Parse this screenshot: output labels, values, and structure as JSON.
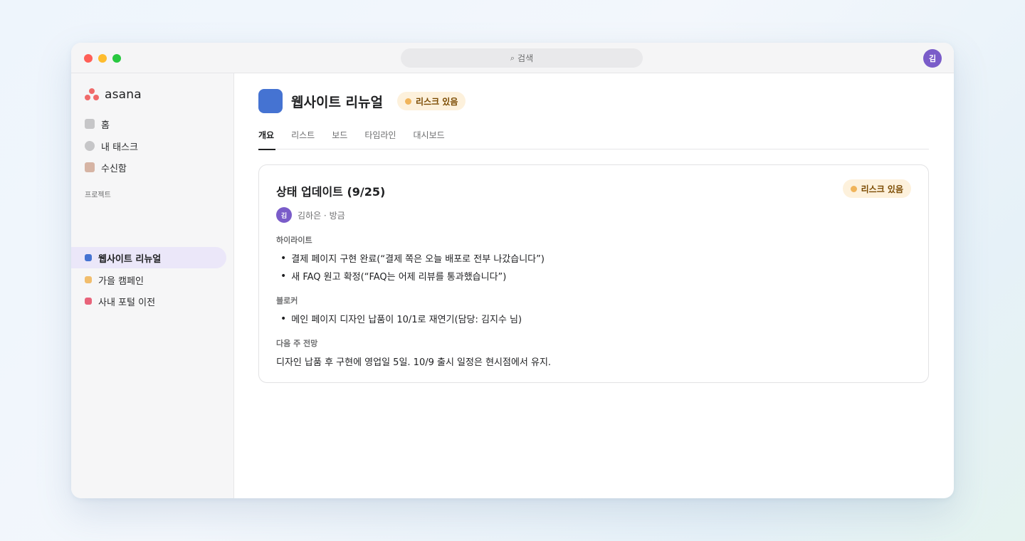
{
  "window": {
    "search_placeholder": "검색",
    "user_initial": "김"
  },
  "sidebar": {
    "logo": "asana",
    "nav": [
      {
        "label": "홈",
        "icon": "home-icon",
        "color": "#c6c6c8"
      },
      {
        "label": "내 태스크",
        "icon": "check-circle-icon",
        "color": "#c6c6c8"
      },
      {
        "label": "수신함",
        "icon": "inbox-icon",
        "color": "#d6b4a4"
      }
    ],
    "section_label": "프로젝트",
    "projects": [
      {
        "label": "웹사이트 리뉴얼",
        "color": "#4573d2",
        "active": true
      },
      {
        "label": "가을 캠페인",
        "color": "#f1bd6c",
        "active": false
      },
      {
        "label": "사내 포털 이전",
        "color": "#e8637a",
        "active": false
      }
    ]
  },
  "project": {
    "title": "웹사이트 리뉴얼",
    "color": "#4573d2",
    "status": "리스크 있음",
    "status_color": "#f0b45a"
  },
  "tabs": [
    "개요",
    "리스트",
    "보드",
    "타임라인",
    "대시보드"
  ],
  "active_tab": "개요",
  "update": {
    "title": "상태 업데이트 (9/25)",
    "status": "리스크 있음",
    "author_initial": "김",
    "author_meta": "김하은 · 방금",
    "highlights_label": "하이라이트",
    "highlights": [
      "결제 페이지 구현 완료(“결제 쪽은 오늘 배포로 전부 나갔습니다”)",
      "새 FAQ 원고 확정(“FAQ는 어제 리뷰를 통과했습니다”)"
    ],
    "blockers_label": "블로커",
    "blockers": [
      "메인 페이지 디자인 납품이 10/1로 재연기(담당: 김지수 님)"
    ],
    "outlook_label": "다음 주 전망",
    "outlook": "디자인 납품 후 구현에 영업일 5일. 10/9 출시 일정은 현시점에서 유지."
  }
}
